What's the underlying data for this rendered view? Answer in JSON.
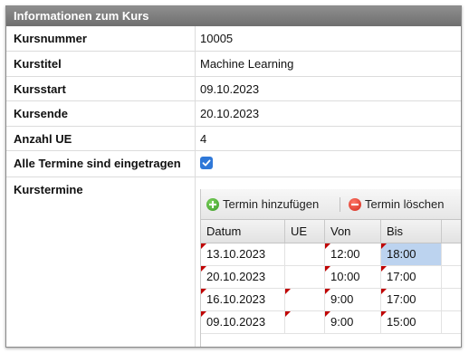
{
  "panel": {
    "title": "Informationen zum Kurs"
  },
  "fields": {
    "kursnummer": {
      "label": "Kursnummer",
      "value": "10005"
    },
    "kurstitel": {
      "label": "Kurstitel",
      "value": "Machine Learning"
    },
    "kursstart": {
      "label": "Kursstart",
      "value": "09.10.2023"
    },
    "kursende": {
      "label": "Kursende",
      "value": "20.10.2023"
    },
    "anzahl_ue": {
      "label": "Anzahl UE",
      "value": "4"
    },
    "alle_termine": {
      "label": "Alle Termine sind eingetragen",
      "checked": true
    },
    "kurstermine": {
      "label": "Kurstermine"
    }
  },
  "toolbar": {
    "add_label": "Termin hinzufügen",
    "delete_label": "Termin löschen"
  },
  "grid": {
    "columns": [
      "Datum",
      "UE",
      "Von",
      "Bis"
    ],
    "rows": [
      {
        "datum": "13.10.2023",
        "ue": "",
        "von": "12:00",
        "bis": "18:00"
      },
      {
        "datum": "20.10.2023",
        "ue": "",
        "von": "10:00",
        "bis": "17:00"
      },
      {
        "datum": "16.10.2023",
        "ue": "",
        "von": "9:00",
        "bis": "17:00"
      },
      {
        "datum": "09.10.2023",
        "ue": "",
        "von": "9:00",
        "bis": "15:00"
      }
    ]
  },
  "colors": {
    "checkbox": "#2f78d8",
    "selected_cell": "#bcd3ef",
    "dirty_marker": "#c00000"
  }
}
